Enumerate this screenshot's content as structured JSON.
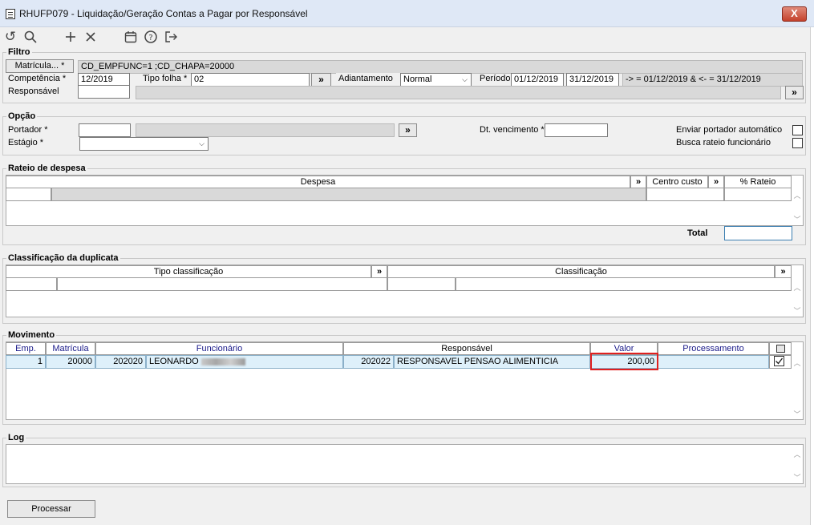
{
  "window": {
    "title": "RHUFP079 - Liquidação/Geração Contas a Pagar por Responsável",
    "close_label": "X"
  },
  "toolbar": {
    "icons": [
      "undo-icon",
      "search-icon",
      "add-icon",
      "delete-icon",
      "calendar-icon",
      "help-icon",
      "exit-icon"
    ]
  },
  "filtro": {
    "legend": "Filtro",
    "matricula_button": "Matrícula... *",
    "matricula_value": "CD_EMPFUNC=1 ;CD_CHAPA=20000",
    "competencia_label": "Competência *",
    "competencia_value": "12/2019",
    "tipo_folha_label": "Tipo folha *",
    "tipo_folha_value": "02",
    "adiantamento_label": "Adiantamento",
    "adiantamento_value": "Normal",
    "periodo_label": "Período",
    "periodo_start": "01/12/2019",
    "periodo_end": "31/12/2019",
    "periodo_expr": "-> = 01/12/2019 & <- = 31/12/2019",
    "responsavel_label": "Responsável",
    "responsavel_value": "",
    "chevron": "»"
  },
  "opcao": {
    "legend": "Opção",
    "portador_label": "Portador *",
    "estagio_label": "Estágio *",
    "dt_vencimento_label": "Dt. vencimento *",
    "enviar_portador_label": "Enviar portador automático",
    "busca_rateio_label": "Busca rateio funcionário"
  },
  "rateio": {
    "legend": "Rateio de despesa",
    "col_despesa": "Despesa",
    "col_centro_custo": "Centro custo",
    "col_rateio": "% Rateio",
    "total_label": "Total"
  },
  "classificacao": {
    "legend": "Classificação da duplicata",
    "col_tipo": "Tipo classificação",
    "col_classificacao": "Classificação"
  },
  "movimento": {
    "legend": "Movimento",
    "columns": {
      "emp": "Emp.",
      "matricula": "Matrícula",
      "funcionario": "Funcionário",
      "responsavel": "Responsável",
      "valor": "Valor",
      "processamento": "Processamento"
    },
    "rows": [
      {
        "emp": "1",
        "matricula": "20000",
        "func_code": "202020",
        "func_name": "LEONARDO",
        "resp_code": "202022",
        "resp_name": "RESPONSAVEL PENSAO ALIMENTICIA",
        "valor": "200,00",
        "processamento": "",
        "checked": true
      }
    ]
  },
  "log": {
    "legend": "Log"
  },
  "footer": {
    "processar_label": "Processar"
  },
  "colors": {
    "row_highlight": "#def0fa",
    "highlight_box": "#e02020",
    "title_bar": "#dfe8f6"
  }
}
